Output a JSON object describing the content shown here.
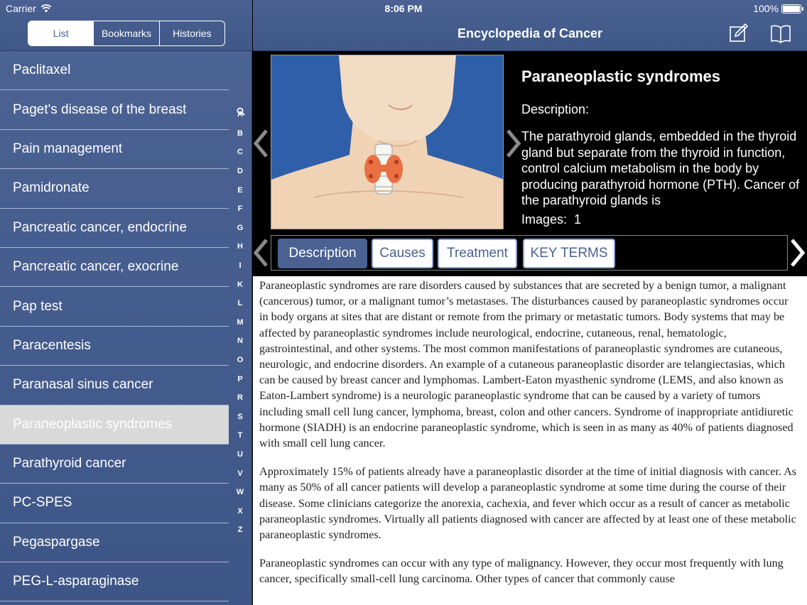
{
  "status_bar": {
    "carrier": "Carrier",
    "time": "8:06 PM",
    "battery": "100%"
  },
  "segments": [
    {
      "label": "List",
      "active": true
    },
    {
      "label": "Bookmarks",
      "active": false
    },
    {
      "label": "Histories",
      "active": false
    }
  ],
  "list": [
    {
      "label": "Paclitaxel"
    },
    {
      "label": "Paget's disease of the breast"
    },
    {
      "label": "Pain management"
    },
    {
      "label": "Pamidronate"
    },
    {
      "label": "Pancreatic cancer, endocrine"
    },
    {
      "label": "Pancreatic cancer, exocrine"
    },
    {
      "label": "Pap test"
    },
    {
      "label": "Paracentesis"
    },
    {
      "label": "Paranasal sinus cancer"
    },
    {
      "label": "Paraneoplastic syndromes",
      "selected": true
    },
    {
      "label": "Parathyroid cancer"
    },
    {
      "label": "PC-SPES"
    },
    {
      "label": "Pegaspargase"
    },
    {
      "label": "PEG-L-asparaginase"
    }
  ],
  "index_letters": [
    "A",
    "B",
    "C",
    "D",
    "E",
    "F",
    "G",
    "H",
    "I",
    "K",
    "L",
    "M",
    "N",
    "O",
    "P",
    "R",
    "S",
    "T",
    "U",
    "V",
    "W",
    "X",
    "Z"
  ],
  "header": {
    "title": "Encyclopedia of Cancer",
    "edit_icon": "compose-icon",
    "book_icon": "book-icon"
  },
  "entry": {
    "title": "Paraneoplastic syndromes",
    "desc_label": "Description:",
    "desc_preview": "The parathyroid glands, embedded in the thyroid gland but separate from the thyroid in function, control calcium metabolism in the body by producing parathyroid hormone (PTH). Cancer of the parathyroid glands is",
    "images_label": "Images:",
    "images_count": "1"
  },
  "tabs": [
    {
      "label": "Description",
      "active": true
    },
    {
      "label": "Causes",
      "active": false
    },
    {
      "label": "Treatment",
      "active": false
    },
    {
      "label": "KEY TERMS",
      "active": false
    }
  ],
  "article": [
    "Paraneoplastic syndromes are rare disorders caused by substances that are secreted by a benign tumor, a malignant (cancerous) tumor, or a malignant tumor’s metastases. The disturbances caused by paraneoplastic syndromes occur in body organs at sites that are distant or remote from the primary or metastatic tumors. Body systems that may be affected by paraneoplastic syndromes include neurological, endocrine, cutaneous, renal, hematologic, gastrointestinal, and other systems. The most common manifestations of paraneoplastic syndromes are cutaneous, neurologic, and endocrine disorders. An example of a cutaneous paraneoplastic disorder are telangiectasias, which can be caused by breast cancer and lymphomas. Lambert-Eaton myasthenic syndrome (LEMS, and also known as Eaton-Lambert syndrome) is a neurologic paraneoplastic syndrome that can be caused by a variety of tumors including small cell lung cancer, lymphoma, breast, colon and other cancers. Syndrome of inappropriate antidiuretic hormone (SIADH) is an endocrine paraneoplastic syndrome, which is seen in as many as 40% of patients diagnosed with small cell lung cancer.",
    "Approximately 15% of patients already have a paraneoplastic disorder at the time of initial diagnosis with cancer. As many as 50% of all cancer patients will develop a paraneoplastic syndrome at some time during the course of their disease. Some clinicians categorize the anorexia, cachexia, and fever which occur as a result of cancer as metabolic paraneoplastic syndromes. Virtually all patients diagnosed with cancer are affected by at least one of these metabolic paraneoplastic syndromes.",
    "Paraneoplastic syndromes can occur with any type of malignancy. However, they occur most frequently with lung cancer, specifically small-cell lung carcinoma. Other types of cancer that commonly cause"
  ]
}
